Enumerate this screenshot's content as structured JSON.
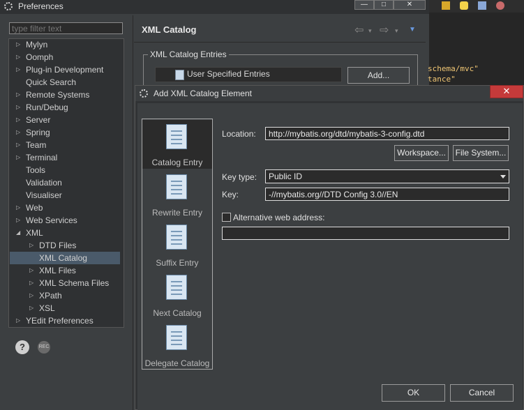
{
  "preferences": {
    "title": "Preferences",
    "filter_placeholder": "type filter text",
    "tree": [
      {
        "label": "Mylyn",
        "indent": 0,
        "expander": "closed"
      },
      {
        "label": "Oomph",
        "indent": 0,
        "expander": "closed"
      },
      {
        "label": "Plug-in Development",
        "indent": 0,
        "expander": "closed"
      },
      {
        "label": "Quick Search",
        "indent": 0,
        "expander": "none"
      },
      {
        "label": "Remote Systems",
        "indent": 0,
        "expander": "closed"
      },
      {
        "label": "Run/Debug",
        "indent": 0,
        "expander": "closed"
      },
      {
        "label": "Server",
        "indent": 0,
        "expander": "closed"
      },
      {
        "label": "Spring",
        "indent": 0,
        "expander": "closed"
      },
      {
        "label": "Team",
        "indent": 0,
        "expander": "closed"
      },
      {
        "label": "Terminal",
        "indent": 0,
        "expander": "closed"
      },
      {
        "label": "Tools",
        "indent": 0,
        "expander": "none"
      },
      {
        "label": "Validation",
        "indent": 0,
        "expander": "none"
      },
      {
        "label": "Visualiser",
        "indent": 0,
        "expander": "none"
      },
      {
        "label": "Web",
        "indent": 0,
        "expander": "closed"
      },
      {
        "label": "Web Services",
        "indent": 0,
        "expander": "closed"
      },
      {
        "label": "XML",
        "indent": 0,
        "expander": "open"
      },
      {
        "label": "DTD Files",
        "indent": 1,
        "expander": "closed"
      },
      {
        "label": "XML Catalog",
        "indent": 1,
        "expander": "none",
        "selected": true
      },
      {
        "label": "XML Files",
        "indent": 1,
        "expander": "closed"
      },
      {
        "label": "XML Schema Files",
        "indent": 1,
        "expander": "closed"
      },
      {
        "label": "XPath",
        "indent": 1,
        "expander": "closed"
      },
      {
        "label": "XSL",
        "indent": 1,
        "expander": "closed"
      },
      {
        "label": "YEdit Preferences",
        "indent": 0,
        "expander": "closed"
      }
    ],
    "help_icon": "?",
    "rec_icon": "REC",
    "page_title": "XML Catalog",
    "entries_group": "XML Catalog Entries",
    "user_entries": "User Specified Entries",
    "add_button": "Add..."
  },
  "editor": {
    "line1": "schema/mvc\"",
    "line2": "tance\""
  },
  "dialog": {
    "title": "Add XML Catalog Element",
    "close": "✕",
    "sidebar": [
      {
        "label": "Catalog Entry",
        "icon": "catalog-entry-icon",
        "selected": true
      },
      {
        "label": "Rewrite Entry",
        "icon": "rewrite-entry-icon"
      },
      {
        "label": "Suffix Entry",
        "icon": "suffix-entry-icon"
      },
      {
        "label": "Next Catalog",
        "icon": "next-catalog-icon"
      },
      {
        "label": "Delegate Catalog",
        "icon": "delegate-catalog-icon"
      }
    ],
    "location_label": "Location:",
    "location_value": "http://mybatis.org/dtd/mybatis-3-config.dtd",
    "workspace_button": "Workspace...",
    "filesystem_button": "File System...",
    "keytype_label": "Key type:",
    "keytype_value": "Public ID",
    "key_label": "Key:",
    "key_value": "-//mybatis.org//DTD Config 3.0//EN",
    "alt_label": "Alternative web address:",
    "alt_value": "",
    "ok_button": "OK",
    "cancel_button": "Cancel"
  }
}
